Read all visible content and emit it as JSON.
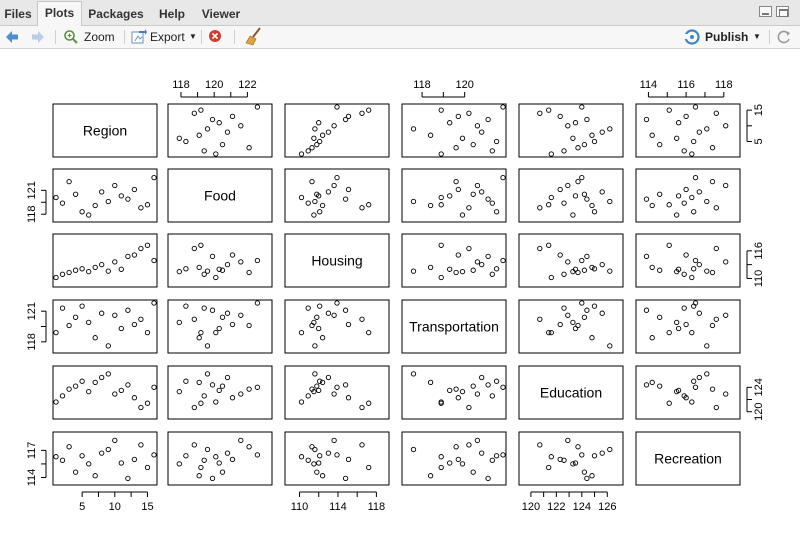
{
  "tabs": [
    "Files",
    "Plots",
    "Packages",
    "Help",
    "Viewer"
  ],
  "toolbar": {
    "zoom": "Zoom",
    "export": "Export",
    "publish": "Publish"
  },
  "chart_data": {
    "type": "scatter",
    "title": "",
    "variables": [
      "Region",
      "Food",
      "Housing",
      "Transportation",
      "Education",
      "Recreation"
    ],
    "ticks": {
      "Region": [
        "5",
        "10",
        "15"
      ],
      "Food": [
        "118",
        "120",
        "122"
      ],
      "Housing": [
        "110",
        "114",
        "118"
      ],
      "Transportation": [
        "118",
        "120"
      ],
      "Education": [
        "120",
        "122",
        "124",
        "126"
      ],
      "Recreation": [
        "114",
        "116",
        "118"
      ]
    },
    "ticks_side": {
      "Region": [
        "5",
        "15"
      ],
      "Food": [
        "118",
        "121"
      ],
      "Housing": [
        "110",
        "116"
      ],
      "Transportation": [
        "118",
        "121"
      ],
      "Education": [
        "120",
        "124"
      ],
      "Recreation": [
        "114",
        "117"
      ]
    },
    "ranges": {
      "Region": [
        1,
        16
      ],
      "Food": [
        117.4,
        123.3
      ],
      "Housing": [
        108.8,
        119.0
      ],
      "Transportation": [
        117.2,
        121.8
      ],
      "Education": [
        119.3,
        127.0
      ],
      "Recreation": [
        113.5,
        118.7
      ]
    },
    "observations": {
      "Region": [
        1,
        2,
        3,
        4,
        5,
        6,
        7,
        8,
        9,
        10,
        11,
        12,
        13,
        14,
        15,
        16
      ],
      "Food": [
        120.1,
        119.4,
        122.1,
        120.5,
        118.3,
        117.9,
        119.1,
        120.8,
        119.6,
        121.6,
        120.3,
        119.9,
        121.1,
        118.8,
        119.2,
        122.6
      ],
      "Housing": [
        110.2,
        110.9,
        111.3,
        111.8,
        112.1,
        111.5,
        112.4,
        113.0,
        111.6,
        113.6,
        112.0,
        114.8,
        115.1,
        116.5,
        117.2,
        113.9
      ],
      "Transportation": [
        118.9,
        121.3,
        119.6,
        120.4,
        121.5,
        119.9,
        118.4,
        120.8,
        117.6,
        120.6,
        119.3,
        121.1,
        119.7,
        120.2,
        118.9,
        121.8
      ],
      "Education": [
        121.6,
        122.6,
        123.7,
        124.2,
        125.0,
        123.3,
        124.8,
        125.6,
        126.2,
        122.9,
        123.5,
        124.4,
        122.3,
        120.7,
        121.4,
        124.0
      ],
      "Recreation": [
        116.3,
        115.9,
        117.4,
        114.6,
        116.4,
        115.5,
        114.2,
        116.7,
        117.1,
        118.1,
        115.6,
        113.9,
        116.0,
        117.6,
        115.1,
        116.5
      ]
    }
  }
}
